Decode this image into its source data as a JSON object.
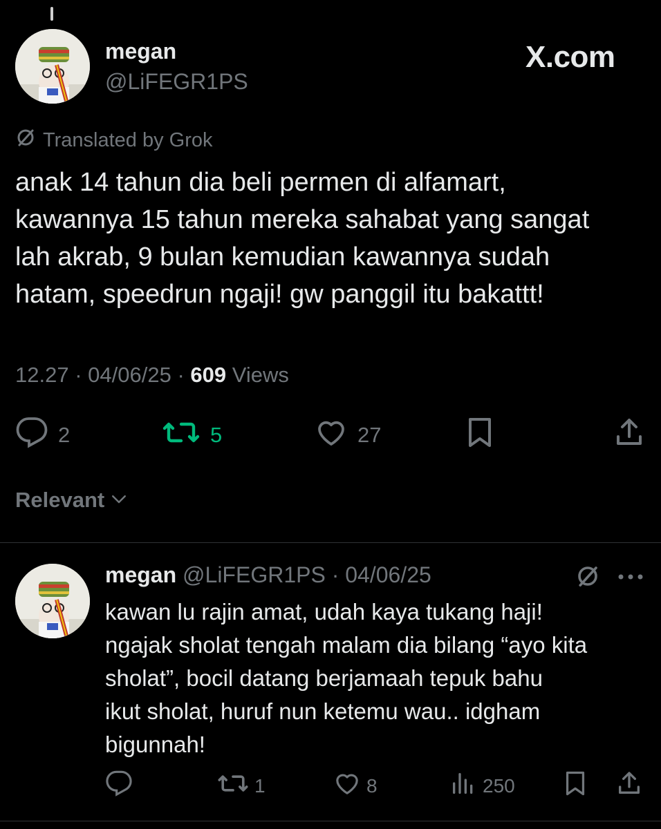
{
  "tweet": {
    "author_name": "megan",
    "author_handle": "@LiFEGR1PS",
    "brand": "X.com",
    "translated_label": "Translated by Grok",
    "text": "anak 14 tahun dia beli permen di alfamart,\nkawannya 15 tahun mereka sahabat yang sangat\nlah akrab, 9 bulan kemudian kawannya sudah\nhatam, speedrun ngaji! gw panggil itu bakattt!",
    "time": "12.27",
    "date": "04/06/25",
    "views_count": "609",
    "views_label": "Views",
    "separator": "·",
    "replies": "2",
    "reposts": "5",
    "likes": "27"
  },
  "sort": {
    "label": "Relevant"
  },
  "reply": {
    "author_name": "megan",
    "author_handle": "@LiFEGR1PS",
    "separator": "·",
    "date": "04/06/25",
    "text": "kawan lu rajin amat, udah kaya tukang haji!\nngajak sholat tengah malam dia bilang “ayo kita\nsholat”, bocil datang berjamaah tepuk bahu\nikut sholat, huruf nun ketemu wau.. idgham\nbigunnah!",
    "reposts": "1",
    "likes": "8",
    "views": "250"
  },
  "colors": {
    "background": "#000000",
    "text": "#e7e9ea",
    "muted": "#71767b",
    "repost_active": "#00ba7c",
    "divider": "#2f3336"
  },
  "icons": [
    "reply-icon",
    "repost-icon",
    "like-icon",
    "bookmark-icon",
    "share-icon",
    "views-icon",
    "translate-icon",
    "more-icon",
    "chevron-down-icon"
  ]
}
